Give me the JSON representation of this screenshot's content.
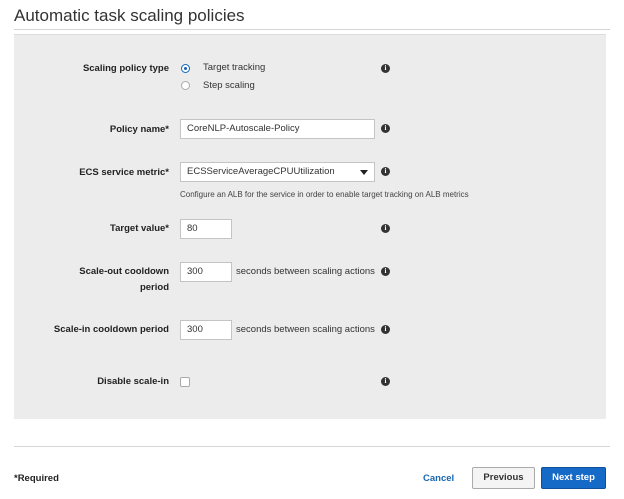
{
  "page_title": "Automatic task scaling policies",
  "form": {
    "policy_type": {
      "label": "Scaling policy type",
      "options": [
        "Target tracking",
        "Step scaling"
      ],
      "selected": "Target tracking",
      "info": "i"
    },
    "policy_name": {
      "label": "Policy name*",
      "value": "CoreNLP-Autoscale-Policy",
      "info": "i"
    },
    "metric": {
      "label": "ECS service metric*",
      "value": "ECSServiceAverageCPUUtilization",
      "help": "Configure an ALB for the service in order to enable target tracking on ALB metrics",
      "info": "i"
    },
    "target_value": {
      "label": "Target value*",
      "value": "80",
      "info": "i"
    },
    "scale_out": {
      "label_line1": "Scale-out cooldown",
      "label_line2": "period",
      "value": "300",
      "unit": "seconds between scaling actions",
      "info": "i"
    },
    "scale_in": {
      "label": "Scale-in cooldown period",
      "value": "300",
      "unit": "seconds between scaling actions",
      "info": "i"
    },
    "disable_scale_in": {
      "label": "Disable scale-in",
      "checked": false,
      "info": "i"
    }
  },
  "footer": {
    "required_note": "*Required",
    "cancel": "Cancel",
    "previous": "Previous",
    "next": "Next step"
  },
  "colors": {
    "accent": "#1569c7",
    "link": "#1a66b3",
    "panel": "#ececec"
  }
}
